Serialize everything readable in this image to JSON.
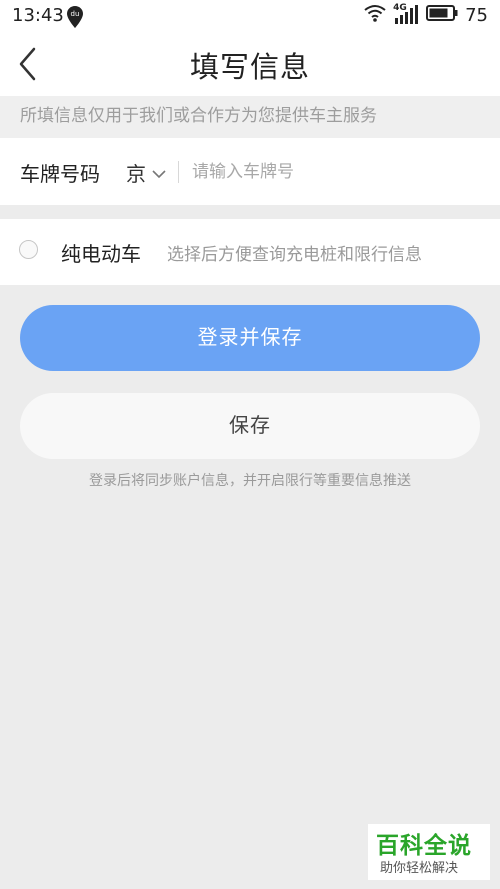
{
  "status_bar": {
    "time": "13:43",
    "network": "4G",
    "battery": "75"
  },
  "header": {
    "title": "填写信息"
  },
  "notice": "所填信息仅用于我们或合作方为您提供车主服务",
  "plate": {
    "label": "车牌号码",
    "province": "京",
    "placeholder": "请输入车牌号"
  },
  "electric": {
    "label": "纯电动车",
    "description": "选择后方便查询充电桩和限行信息"
  },
  "buttons": {
    "login_save": "登录并保存",
    "save": "保存"
  },
  "hint": "登录后将同步账户信息，并开启限行等重要信息推送",
  "watermark": {
    "title": "百科全说",
    "subtitle": "助你轻松解决"
  },
  "colors": {
    "primary_button": "#6aa3f4",
    "background": "#ececec"
  }
}
